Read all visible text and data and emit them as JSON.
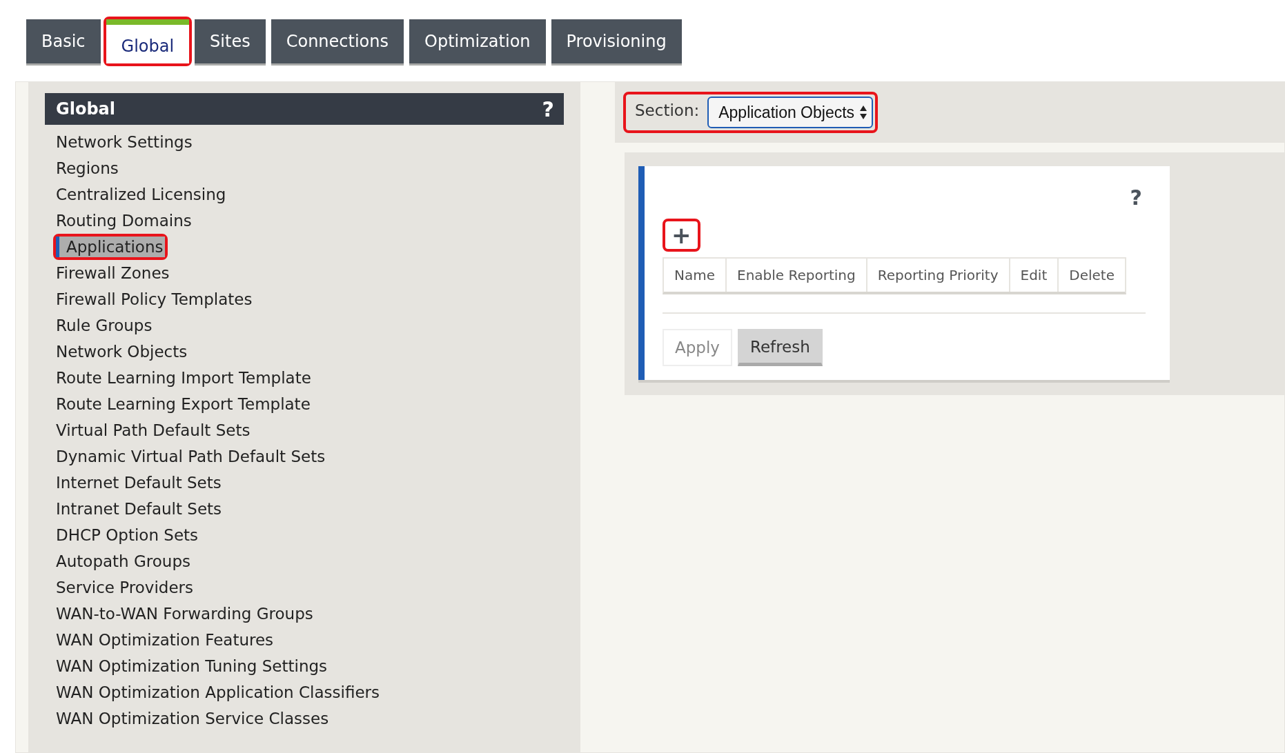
{
  "tabs": [
    {
      "label": "Basic",
      "selected": false,
      "highlighted": false
    },
    {
      "label": "Global",
      "selected": true,
      "highlighted": true
    },
    {
      "label": "Sites",
      "selected": false,
      "highlighted": false
    },
    {
      "label": "Connections",
      "selected": false,
      "highlighted": false
    },
    {
      "label": "Optimization",
      "selected": false,
      "highlighted": false
    },
    {
      "label": "Provisioning",
      "selected": false,
      "highlighted": false
    }
  ],
  "sidebar": {
    "title": "Global",
    "help": "?",
    "items": [
      {
        "label": "Network Settings",
        "selected": false,
        "highlighted": false
      },
      {
        "label": "Regions",
        "selected": false,
        "highlighted": false
      },
      {
        "label": "Centralized Licensing",
        "selected": false,
        "highlighted": false
      },
      {
        "label": "Routing Domains",
        "selected": false,
        "highlighted": false
      },
      {
        "label": "Applications",
        "selected": true,
        "highlighted": true
      },
      {
        "label": "Firewall Zones",
        "selected": false,
        "highlighted": false
      },
      {
        "label": "Firewall Policy Templates",
        "selected": false,
        "highlighted": false
      },
      {
        "label": "Rule Groups",
        "selected": false,
        "highlighted": false
      },
      {
        "label": "Network Objects",
        "selected": false,
        "highlighted": false
      },
      {
        "label": "Route Learning Import Template",
        "selected": false,
        "highlighted": false
      },
      {
        "label": "Route Learning Export Template",
        "selected": false,
        "highlighted": false
      },
      {
        "label": "Virtual Path Default Sets",
        "selected": false,
        "highlighted": false
      },
      {
        "label": "Dynamic Virtual Path Default Sets",
        "selected": false,
        "highlighted": false
      },
      {
        "label": "Internet Default Sets",
        "selected": false,
        "highlighted": false
      },
      {
        "label": "Intranet Default Sets",
        "selected": false,
        "highlighted": false
      },
      {
        "label": "DHCP Option Sets",
        "selected": false,
        "highlighted": false
      },
      {
        "label": "Autopath Groups",
        "selected": false,
        "highlighted": false
      },
      {
        "label": "Service Providers",
        "selected": false,
        "highlighted": false
      },
      {
        "label": "WAN-to-WAN Forwarding Groups",
        "selected": false,
        "highlighted": false
      },
      {
        "label": "WAN Optimization Features",
        "selected": false,
        "highlighted": false
      },
      {
        "label": "WAN Optimization Tuning Settings",
        "selected": false,
        "highlighted": false
      },
      {
        "label": "WAN Optimization Application Classifiers",
        "selected": false,
        "highlighted": false
      },
      {
        "label": "WAN Optimization Service Classes",
        "selected": false,
        "highlighted": false
      }
    ]
  },
  "section": {
    "label": "Section:",
    "value": "Application Objects",
    "highlighted": true
  },
  "panel": {
    "help": "?",
    "add": {
      "label": "+",
      "highlighted": true
    },
    "table": {
      "columns": [
        "Name",
        "Enable Reporting",
        "Reporting Priority",
        "Edit",
        "Delete"
      ]
    },
    "buttons": [
      {
        "label": "Apply",
        "disabled": true
      },
      {
        "label": "Refresh",
        "disabled": false
      }
    ]
  }
}
